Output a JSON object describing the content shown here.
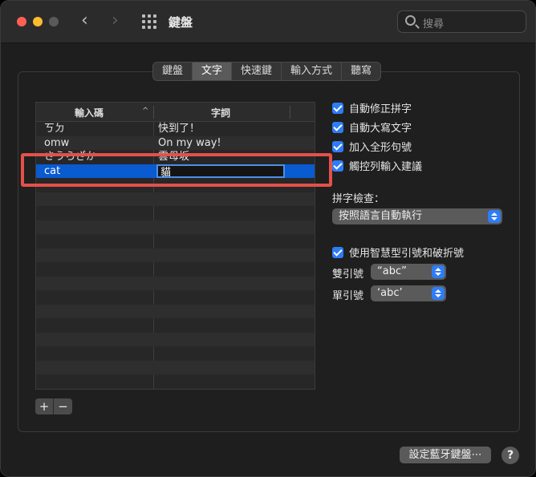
{
  "window": {
    "title": "鍵盤"
  },
  "search": {
    "placeholder": "搜尋"
  },
  "tabs": [
    {
      "label": "鍵盤",
      "active": false
    },
    {
      "label": "文字",
      "active": true
    },
    {
      "label": "快速鍵",
      "active": false
    },
    {
      "label": "輸入方式",
      "active": false
    },
    {
      "label": "聽寫",
      "active": false
    }
  ],
  "table": {
    "col_input": "輸入碼",
    "col_phrase": "字詞",
    "sort_indicator": "^",
    "rows": [
      {
        "input": "ㄎㄉ",
        "phrase": "快到了！"
      },
      {
        "input": "omw",
        "phrase": "On my way!"
      },
      {
        "input": "さうらざか",
        "phrase": "雲母坂"
      },
      {
        "input": "cat",
        "phrase": "貓",
        "selected": true,
        "editing": true
      }
    ],
    "add_label": "+",
    "remove_label": "−"
  },
  "options": {
    "autocorrect": {
      "label": "自動修正拼字",
      "checked": true
    },
    "autocapitalize": {
      "label": "自動大寫文字",
      "checked": true
    },
    "fullwidth_period": {
      "label": "加入全形句號",
      "checked": true
    },
    "touchbar_suggestions": {
      "label": "觸控列輸入建議",
      "checked": true
    },
    "spelling_title": "拼字檢查：",
    "spelling_value": "按照語言自動執行",
    "smart_quotes": {
      "label": "使用智慧型引號和破折號",
      "checked": true
    },
    "double_quote_label": "雙引號",
    "double_quote_value": "“abc”",
    "single_quote_label": "單引號",
    "single_quote_value": "‘abc’"
  },
  "footer": {
    "bluetooth_button": "設定藍牙鍵盤⋯",
    "help_button": "?"
  },
  "colors": {
    "accent": "#2e7cf6",
    "selection": "#0a5ad0",
    "highlight_box": "#e4504a"
  }
}
